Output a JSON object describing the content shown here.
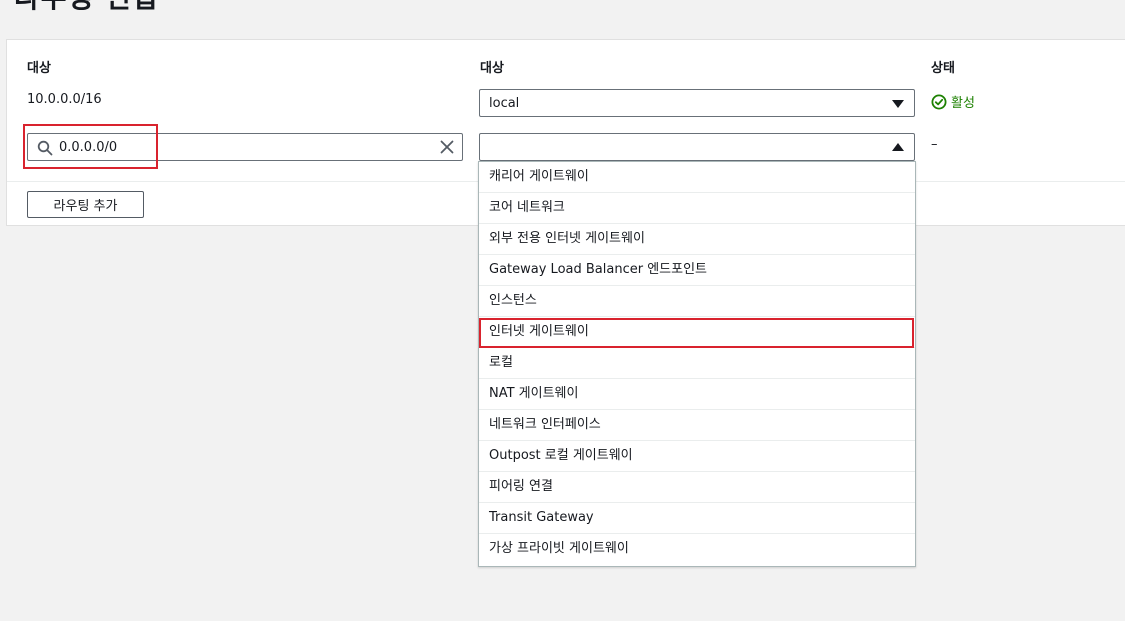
{
  "page": {
    "title": "라우팅 편집"
  },
  "columns": {
    "destination_label": "대상",
    "target_label": "대상",
    "status_label": "상태"
  },
  "rows": [
    {
      "destination": "10.0.0.0/16",
      "target": "local",
      "status": "활성",
      "status_icon": "check-circle-icon"
    },
    {
      "destination": "0.0.0.0/0",
      "target": "",
      "status": "–"
    }
  ],
  "add_route_button": "라우팅 추가",
  "dropdown": {
    "options": [
      "캐리어 게이트웨이",
      "코어 네트워크",
      "외부 전용 인터넷 게이트웨이",
      "Gateway Load Balancer 엔드포인트",
      "인스턴스",
      "인터넷 게이트웨이",
      "로컬",
      "NAT 게이트웨이",
      "네트워크 인터페이스",
      "Outpost 로컬 게이트웨이",
      "피어링 연결",
      "Transit Gateway",
      "가상 프라이빗 게이트웨이"
    ],
    "highlighted": "인터넷 게이트웨이"
  },
  "colors": {
    "status_active": "#1d8102",
    "highlight_border": "#d9232e"
  }
}
